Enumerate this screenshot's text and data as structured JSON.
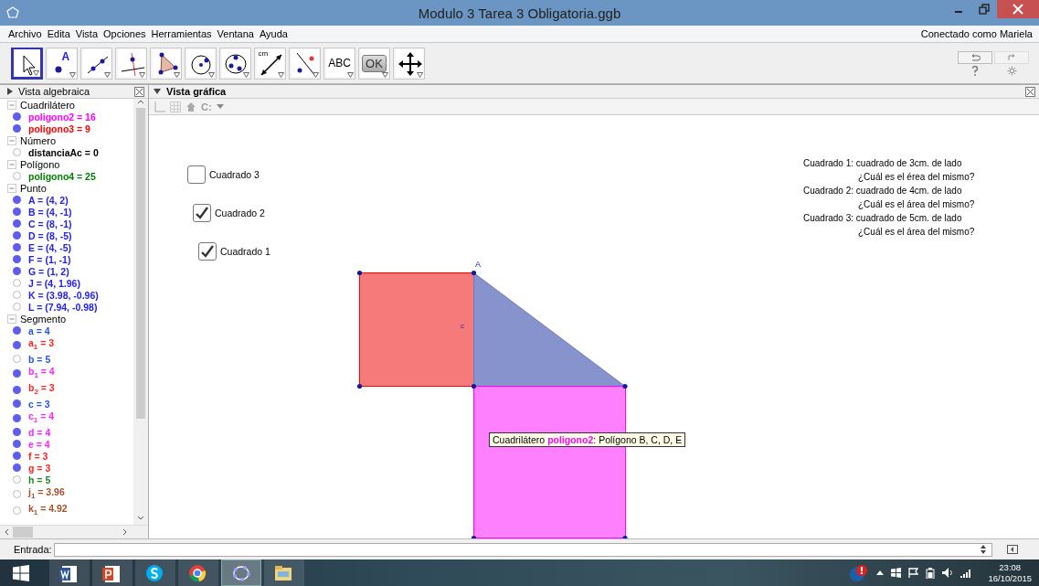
{
  "window": {
    "title": "Modulo 3 Tarea 3 Obligatoria.ggb"
  },
  "menu": [
    "Archivo",
    "Edita",
    "Vista",
    "Opciones",
    "Herramientas",
    "Ventana",
    "Ayuda"
  ],
  "account": "Conectado como Mariela",
  "tools": [
    {
      "kind": "move",
      "selected": true
    },
    {
      "kind": "point",
      "selected": false,
      "label": "A"
    },
    {
      "kind": "line",
      "selected": false
    },
    {
      "kind": "perpendicular",
      "selected": false
    },
    {
      "kind": "polygon",
      "selected": false
    },
    {
      "kind": "circle",
      "selected": false
    },
    {
      "kind": "conic",
      "selected": false
    },
    {
      "kind": "measure",
      "selected": false,
      "label": "cm"
    },
    {
      "kind": "reflect",
      "selected": false
    },
    {
      "kind": "text",
      "selected": false,
      "label": "ABC"
    },
    {
      "kind": "button",
      "selected": false,
      "label": "OK"
    },
    {
      "kind": "pan",
      "selected": false
    }
  ],
  "algebra": {
    "title": "Vista algebraica",
    "groups": [
      {
        "name": "Cuadrilátero",
        "items": [
          {
            "text": "poligono2 = 16",
            "color": "#ff00ff",
            "shown": true
          },
          {
            "text": "poligono3 = 9",
            "color": "#ff0000",
            "shown": true
          }
        ]
      },
      {
        "name": "Número",
        "items": [
          {
            "text": "distanciaAc = 0",
            "color": "#000000",
            "shown": false
          }
        ]
      },
      {
        "name": "Polígono",
        "items": [
          {
            "text": "poligono4 = 25",
            "color": "#008000",
            "shown": false
          }
        ]
      },
      {
        "name": "Punto",
        "items": [
          {
            "text": "A = (4, 2)",
            "color": "#2222ee",
            "shown": true
          },
          {
            "text": "B = (4, -1)",
            "color": "#2222ee",
            "shown": true
          },
          {
            "text": "C = (8, -1)",
            "color": "#2222ee",
            "shown": true
          },
          {
            "text": "D = (8, -5)",
            "color": "#2222ee",
            "shown": true
          },
          {
            "text": "E = (4, -5)",
            "color": "#2222ee",
            "shown": true
          },
          {
            "text": "F = (1, -1)",
            "color": "#2222ee",
            "shown": true
          },
          {
            "text": "G = (1, 2)",
            "color": "#2222ee",
            "shown": true
          },
          {
            "text": "J = (4, 1.96)",
            "color": "#2222ee",
            "shown": false
          },
          {
            "text": "K = (3.98, -0.96)",
            "color": "#2222ee",
            "shown": false
          },
          {
            "text": "L = (7.94, -0.98)",
            "color": "#2222ee",
            "shown": false
          }
        ]
      },
      {
        "name": "Segmento",
        "items": [
          {
            "text": "a = 4",
            "color": "#2255dd",
            "shown": true
          },
          {
            "text": "a$_{1}$ = 3",
            "color": "#ff2222",
            "shown": true
          },
          {
            "text": "b = 5",
            "color": "#2255dd",
            "shown": false
          },
          {
            "text": "b$_{1}$ = 4",
            "color": "#ff22ff",
            "shown": true
          },
          {
            "text": "b$_{2}$ = 3",
            "color": "#ff2222",
            "shown": true
          },
          {
            "text": "c = 3",
            "color": "#2255dd",
            "shown": true
          },
          {
            "text": "c$_{1}$ = 4",
            "color": "#ff22ff",
            "shown": true
          },
          {
            "text": "d = 4",
            "color": "#ff22ff",
            "shown": true
          },
          {
            "text": "e = 4",
            "color": "#ff22ff",
            "shown": true
          },
          {
            "text": "f = 3",
            "color": "#ff2222",
            "shown": true
          },
          {
            "text": "g = 3",
            "color": "#ff2222",
            "shown": true
          },
          {
            "text": "h = 5",
            "color": "#228822",
            "shown": false
          },
          {
            "text": "j$_{1}$ = 3.96",
            "color": "#a0522d",
            "shown": false
          },
          {
            "text": "k$_{1}$ = 4.92",
            "color": "#a0522d",
            "shown": false
          }
        ]
      }
    ]
  },
  "graphics": {
    "title": "Vista gráfica",
    "style_label": "C:",
    "checkboxes": [
      {
        "label": "Cuadrado 3",
        "checked": false
      },
      {
        "label": "Cuadrado 2",
        "checked": true
      },
      {
        "label": "Cuadrado 1",
        "checked": true
      }
    ],
    "instructions": [
      "Cuadrado 1: cuadrado de 3cm. de lado",
      "¿Cuál es el érea del mismo?",
      "Cuadrado 2: cuadrado de 4cm. de lado",
      "¿Cuál es el área del mismo?",
      "Cuadrado 3: cuadrado de 5cm. de lado",
      "¿Cuál es el área del mismo?"
    ],
    "point_label": "A",
    "segment_label": "c",
    "tooltip": "Cuadrilátero **poligono2**: Polígono B, C, D, E"
  },
  "input": {
    "label": "Entrada:"
  },
  "taskbar": {
    "time": "23:08",
    "date": "16/10/2015"
  }
}
